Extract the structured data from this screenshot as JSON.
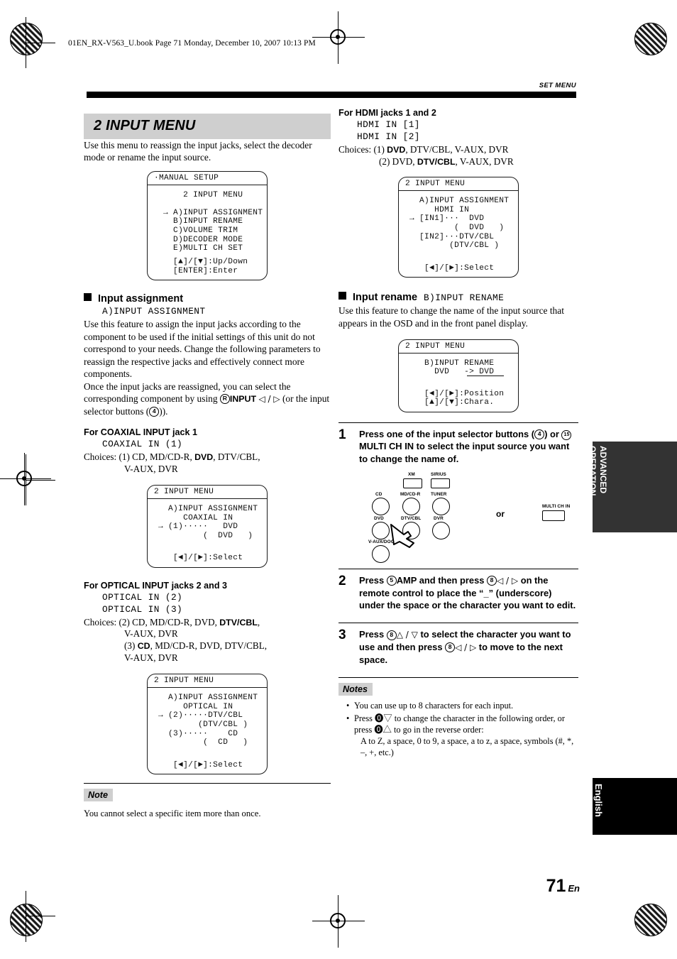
{
  "header": {
    "book_line": "01EN_RX-V563_U.book  Page 71  Monday, December 10, 2007  10:13 PM",
    "running_head": "SET MENU"
  },
  "left_column": {
    "section_title": "2 INPUT MENU",
    "intro": "Use this menu to reassign the input jacks, select the decoder mode or rename the input source.",
    "osd_main": {
      "title": "·MANUAL SETUP",
      "body": "      2 INPUT MENU\n\n  → A)INPUT ASSIGNMENT\n    B)INPUT RENAME\n    C)VOLUME TRIM\n    D)DECODER MODE\n    E)MULTI CH SET",
      "footer": "    [▲]/[▼]:Up/Down\n    [ENTER]:Enter"
    },
    "input_assignment": {
      "heading": "Input assignment",
      "osd_name": "A)INPUT ASSIGNMENT",
      "para1": "Use this feature to assign the input jacks according to the component to be used if the initial settings of this unit do not correspond to your needs. Change the following parameters to reassign the respective jacks and effectively connect more components.",
      "para2_a": "Once the input jacks are reassigned, you can select the corresponding component by using ",
      "para2_b": "INPUT",
      "para2_c": " (or the input selector buttons (",
      "para2_d": ")).",
      "circ_r": "R",
      "circ_4": "4"
    },
    "coaxial": {
      "heading": "For COAXIAL INPUT jack 1",
      "osd_name": "COAXIAL IN (1)",
      "choices_label": "Choices:",
      "choices_line1_pre": "(1) CD, MD/CD-R, ",
      "choices_line1_bold": "DVD",
      "choices_line1_post": ", DTV/CBL,",
      "choices_line2": "V-AUX, DVR"
    },
    "osd_coaxial": {
      "title": "2 INPUT MENU",
      "body": "   A)INPUT ASSIGNMENT\n      COAXIAL IN\n → (1)·····   DVD\n          (  DVD   )",
      "footer": "\n    [◄]/[►]:Select"
    },
    "optical": {
      "heading": "For OPTICAL INPUT jacks 2 and 3",
      "osd_name1": "OPTICAL IN (2)",
      "osd_name2": "OPTICAL IN (3)",
      "choices_label": "Choices:",
      "line1_pre": "(2) CD, MD/CD-R, DVD, ",
      "line1_bold": "DTV/CBL",
      "line1_post": ",",
      "line2": "V-AUX, DVR",
      "line3_pre": "(3) ",
      "line3_bold": "CD",
      "line3_post": ", MD/CD-R, DVD, DTV/CBL,",
      "line4": "V-AUX, DVR"
    },
    "osd_optical": {
      "title": "2 INPUT MENU",
      "body": "   A)INPUT ASSIGNMENT\n      OPTICAL IN\n → (2)·····DTV/CBL\n         (DTV/CBL )\n   (3)·····    CD\n          (  CD   )",
      "footer": "\n    [◄]/[►]:Select"
    },
    "note": {
      "tag": "Note",
      "text": "You cannot select a specific item more than once."
    }
  },
  "right_column": {
    "hdmi": {
      "heading": "For HDMI jacks 1 and 2",
      "osd_name1": "HDMI IN [1]",
      "osd_name2": "HDMI IN [2]",
      "choices_label": "Choices:",
      "line1_pre": "(1) ",
      "line1_bold": "DVD",
      "line1_post": ", DTV/CBL, V-AUX, DVR",
      "line2_pre": "(2) DVD, ",
      "line2_bold": "DTV/CBL",
      "line2_post": ", V-AUX, DVR"
    },
    "osd_hdmi": {
      "title": "2 INPUT MENU",
      "body": "   A)INPUT ASSIGNMENT\n      HDMI IN\n → [IN1]···  DVD\n          (  DVD   )\n   [IN2]···DTV/CBL\n         (DTV/CBL )",
      "footer": "\n    [◄]/[►]:Select"
    },
    "input_rename": {
      "heading": "Input rename",
      "osd_name": "B)INPUT RENAME",
      "para": "Use this feature to change the name of the input source that appears in the OSD and in the front panel display."
    },
    "osd_rename": {
      "title": "2 INPUT MENU",
      "body": "    B)INPUT RENAME\n      DVD   -> DVD",
      "footer": "\n    [◄]/[►]:Position\n    [▲]/[▼]:Chara."
    },
    "steps": [
      {
        "num": "1",
        "pre": "Press one of the input selector buttons (",
        "c1": "4",
        "mid": ") or ",
        "c2": "15",
        "bold": "MULTI CH IN",
        "post": " to select the input source you want to change the name of."
      },
      {
        "num": "2",
        "pre": "Press ",
        "c1": "5",
        "bold": "AMP",
        "mid": " and then press ",
        "c2": "8",
        "arrows": "◁ / ▷",
        "post": " on the remote control to place the “_” (underscore) under the space or the character you want to edit."
      },
      {
        "num": "3",
        "pre": "Press ",
        "c1": "8",
        "arrows": "△ / ▽",
        "mid": " to select the character you want to use and then press ",
        "c2": "8",
        "arrows2": "◁ / ▷",
        "post": " to move to the next space."
      }
    ],
    "figure": {
      "buttons_top": [
        "XM",
        "SIRIUS"
      ],
      "buttons_row1": [
        "CD",
        "MD/CD-R",
        "TUNER"
      ],
      "buttons_row2": [
        "DVD",
        "DTV/CBL",
        "DVR"
      ],
      "buttons_row3": [
        "V-AUX/DOCK"
      ],
      "or_label": "or",
      "multi_ch_in": "MULTI CH IN"
    },
    "notes": {
      "tag": "Notes",
      "items": [
        "You can use up to 8 characters for each input.",
        "Press ⓿▽ to change the character in the following order, or press ⓿△ to go in the reverse order:",
        "A to Z, a space, 0 to 9, a space, a to z, a space, symbols (#, *, –, +, etc.)"
      ]
    }
  },
  "side_tabs": {
    "advanced": "ADVANCED\nOPERATION",
    "advanced_line1": "ADVANCED",
    "advanced_line2": "OPERATION",
    "language": "English"
  },
  "footer": {
    "page_number": "71",
    "page_suffix": "En"
  },
  "colors": {
    "gray_band": "#cfcfcf",
    "tab_gray": "#333333",
    "tab_black": "#000000"
  }
}
